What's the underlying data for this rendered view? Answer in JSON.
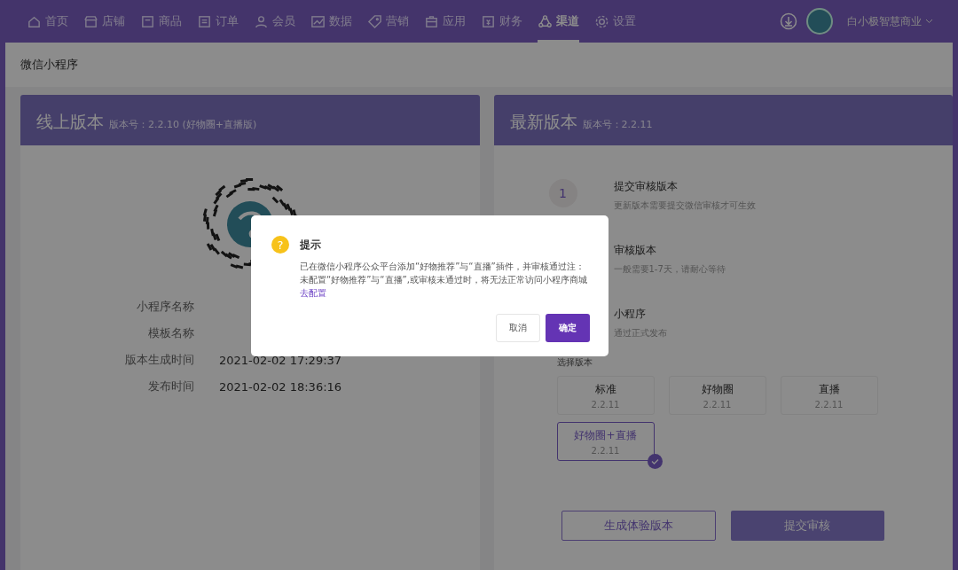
{
  "nav": {
    "items": [
      {
        "label": "首页",
        "selected": false
      },
      {
        "label": "店铺",
        "selected": false
      },
      {
        "label": "商品",
        "selected": false
      },
      {
        "label": "订单",
        "selected": false
      },
      {
        "label": "会员",
        "selected": false
      },
      {
        "label": "数据",
        "selected": false
      },
      {
        "label": "营销",
        "selected": false
      },
      {
        "label": "应用",
        "selected": false
      },
      {
        "label": "财务",
        "selected": false
      },
      {
        "label": "渠道",
        "selected": true
      },
      {
        "label": "设置",
        "selected": false
      }
    ],
    "account": "白小极智慧商业"
  },
  "page": {
    "title": "微信小程序"
  },
  "online": {
    "title": "线上版本",
    "version": "版本号：2.2.10 (好物圈+直播版)",
    "details": [
      {
        "label": "小程序名称"
      },
      {
        "label": "模板名称"
      },
      {
        "label": "版本生成时间",
        "value": "2021-02-02 17:29:37"
      },
      {
        "label": "发布时间",
        "value": "2021-02-02 18:36:16"
      }
    ]
  },
  "latest": {
    "title": "最新版本",
    "version": "版本号：2.2.11",
    "steps": [
      {
        "number": "1",
        "title": "提交审核版本",
        "desc": "更新版本需要提交微信审核才可生效"
      },
      {
        "title": "审核版本",
        "desc": "一般需要1-7天，请耐心等待"
      },
      {
        "title": "小程序",
        "desc": "通过正式发布"
      }
    ],
    "select_label": "选择版本",
    "options": [
      {
        "name": "标准",
        "version": "2.2.11",
        "selected": false
      },
      {
        "name": "好物圈",
        "version": "2.2.11",
        "selected": false
      },
      {
        "name": "直播",
        "version": "2.2.11",
        "selected": false
      },
      {
        "name": "好物圈+直播",
        "version": "2.2.11",
        "selected": true
      }
    ],
    "buttons": {
      "secondary": "生成体验版本",
      "primary": "提交审核"
    }
  },
  "dialog": {
    "icon": "?",
    "title": "提示",
    "message": "已在微信小程序公众平台添加“好物推荐”与“直播”插件，并审核通过注：未配置“好物推荐”与“直播”,或审核未通过时，将无法正常访问小程序商城",
    "link": "去配置",
    "cancel": "取消",
    "confirm": "确定"
  }
}
